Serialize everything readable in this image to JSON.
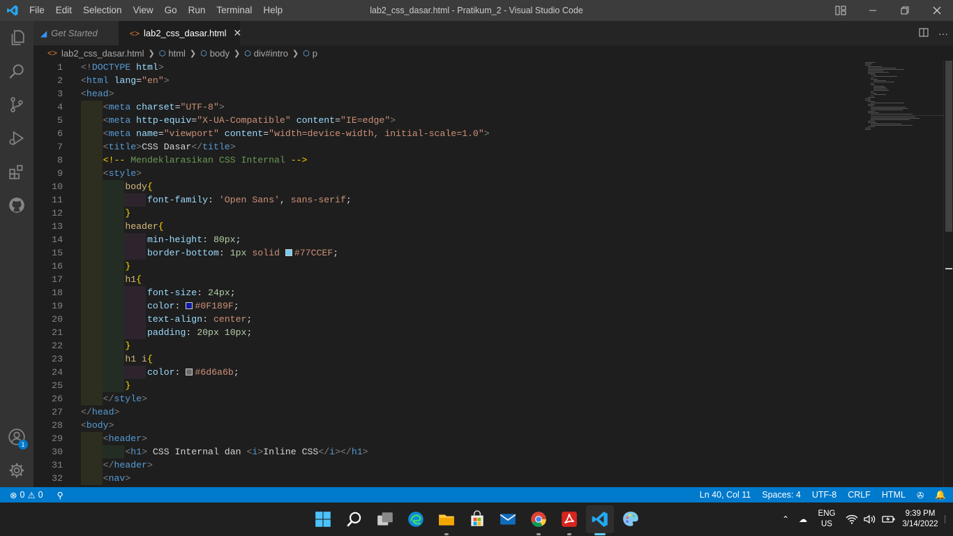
{
  "titlebar": {
    "menu": [
      "File",
      "Edit",
      "Selection",
      "View",
      "Go",
      "Run",
      "Terminal",
      "Help"
    ],
    "window_title": "lab2_css_dasar.html - Pratikum_2 - Visual Studio Code"
  },
  "activity_bar": {
    "items": [
      "explorer-icon",
      "search-icon",
      "source-control-icon",
      "run-debug-icon",
      "extensions-icon",
      "github-icon"
    ],
    "bottom": [
      "accounts-icon",
      "settings-gear-icon"
    ],
    "accounts_badge": "1"
  },
  "tabs": [
    {
      "label": "Get Started",
      "active": false
    },
    {
      "label": "lab2_css_dasar.html",
      "active": true
    }
  ],
  "breadcrumb": [
    "lab2_css_dasar.html",
    "html",
    "body",
    "div#intro",
    "p"
  ],
  "editor": {
    "lines": [
      {
        "n": "1"
      },
      {
        "n": "2"
      },
      {
        "n": "3"
      },
      {
        "n": "4"
      },
      {
        "n": "5"
      },
      {
        "n": "6"
      },
      {
        "n": "7"
      },
      {
        "n": "8"
      },
      {
        "n": "9"
      },
      {
        "n": "10"
      },
      {
        "n": "11"
      },
      {
        "n": "12"
      },
      {
        "n": "13"
      },
      {
        "n": "14"
      },
      {
        "n": "15"
      },
      {
        "n": "16"
      },
      {
        "n": "17"
      },
      {
        "n": "18"
      },
      {
        "n": "19"
      },
      {
        "n": "20"
      },
      {
        "n": "21"
      },
      {
        "n": "22"
      },
      {
        "n": "23"
      },
      {
        "n": "24"
      },
      {
        "n": "25"
      },
      {
        "n": "26"
      },
      {
        "n": "27"
      },
      {
        "n": "28"
      },
      {
        "n": "29"
      },
      {
        "n": "30"
      },
      {
        "n": "31"
      },
      {
        "n": "32"
      }
    ],
    "swatch_colors": {
      "light_blue": "#77CCEF",
      "dark_blue": "#0F189F",
      "gray": "#6d6a6b"
    }
  },
  "statusbar": {
    "errors": "0",
    "warnings": "0",
    "position": "Ln 40, Col 11",
    "spaces": "Spaces: 4",
    "encoding": "UTF-8",
    "eol": "CRLF",
    "language": "HTML"
  },
  "taskbar": {
    "lang_top": "ENG",
    "lang_bottom": "US",
    "time": "9:39 PM",
    "date": "3/14/2022"
  }
}
